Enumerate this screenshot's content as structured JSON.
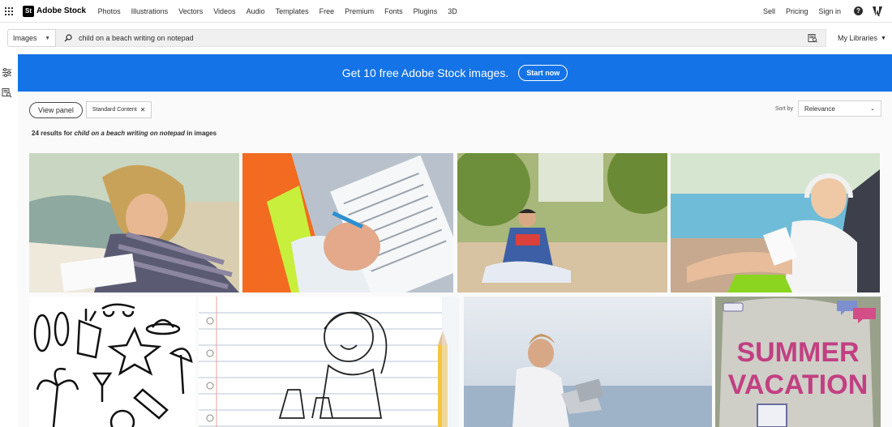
{
  "brand": {
    "mark": "St",
    "name": "Adobe Stock"
  },
  "nav": {
    "links": [
      "Photos",
      "Illustrations",
      "Vectors",
      "Videos",
      "Audio",
      "Templates",
      "Free",
      "Premium",
      "Fonts",
      "Plugins",
      "3D"
    ],
    "right": {
      "sell": "Sell",
      "pricing": "Pricing",
      "signin": "Sign in",
      "help": "?"
    }
  },
  "search": {
    "scope": "Images",
    "query": "child on a beach writing on notepad",
    "libraries": "My Libraries"
  },
  "banner": {
    "text": "Get 10 free Adobe Stock images.",
    "button": "Start now",
    "color": "#1473e6"
  },
  "filters": {
    "view_panel": "View panel",
    "chip": "Standard Content",
    "chip_close": "✕"
  },
  "sort": {
    "label": "Sort by",
    "value": "Relevance"
  },
  "results": {
    "prefix": "24 results for ",
    "query": "child on a beach writing on notepad",
    "suffix": " in images"
  },
  "thumbnails": {
    "summer_text": [
      "SUMMER",
      "VACATION"
    ]
  }
}
